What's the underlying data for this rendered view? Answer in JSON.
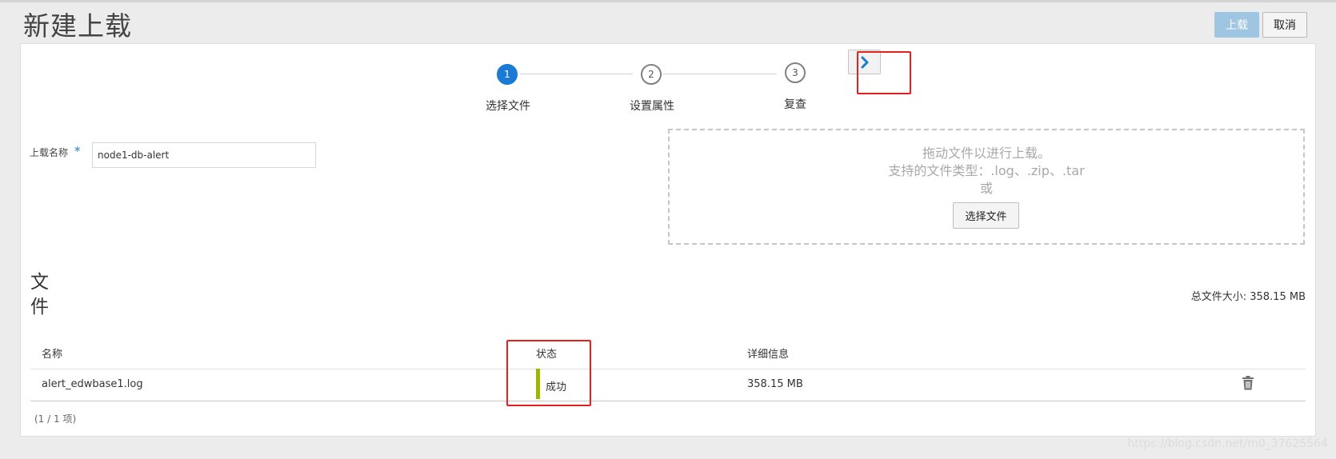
{
  "page": {
    "title": "新建上载"
  },
  "header": {
    "upload_label": "上载",
    "cancel_label": "取消"
  },
  "train": {
    "steps": [
      {
        "number": "1",
        "label": "选择文件",
        "state": "active"
      },
      {
        "number": "2",
        "label": "设置属性",
        "state": "inactive"
      },
      {
        "number": "3",
        "label": "复查",
        "state": "inactive"
      }
    ],
    "next_icon": "chevron-right-icon"
  },
  "form": {
    "name_label": "上载名称",
    "required_marker": "*",
    "name_value": "node1-db-alert"
  },
  "dropzone": {
    "line1": "拖动文件以进行上载。",
    "line2": "支持的文件类型：.log、.zip、.tar",
    "line3": "或",
    "choose_label": "选择文件"
  },
  "files": {
    "heading_line1": "文",
    "heading_line2": "件",
    "total_size_label": "总文件大小: 358.15 MB",
    "columns": {
      "name": "名称",
      "status": "状态",
      "detail": "详细信息"
    },
    "rows": [
      {
        "name": "alert_edwbase1.log",
        "status": "成功",
        "detail": "358.15 MB",
        "delete_icon": "trash-icon"
      }
    ],
    "pager": "(1 / 1 项)"
  },
  "colors": {
    "accent": "#1a7ad4",
    "success": "#9ab800",
    "highlight": "#e8201c"
  },
  "watermark": "https://blog.csdn.net/m0_37625564"
}
